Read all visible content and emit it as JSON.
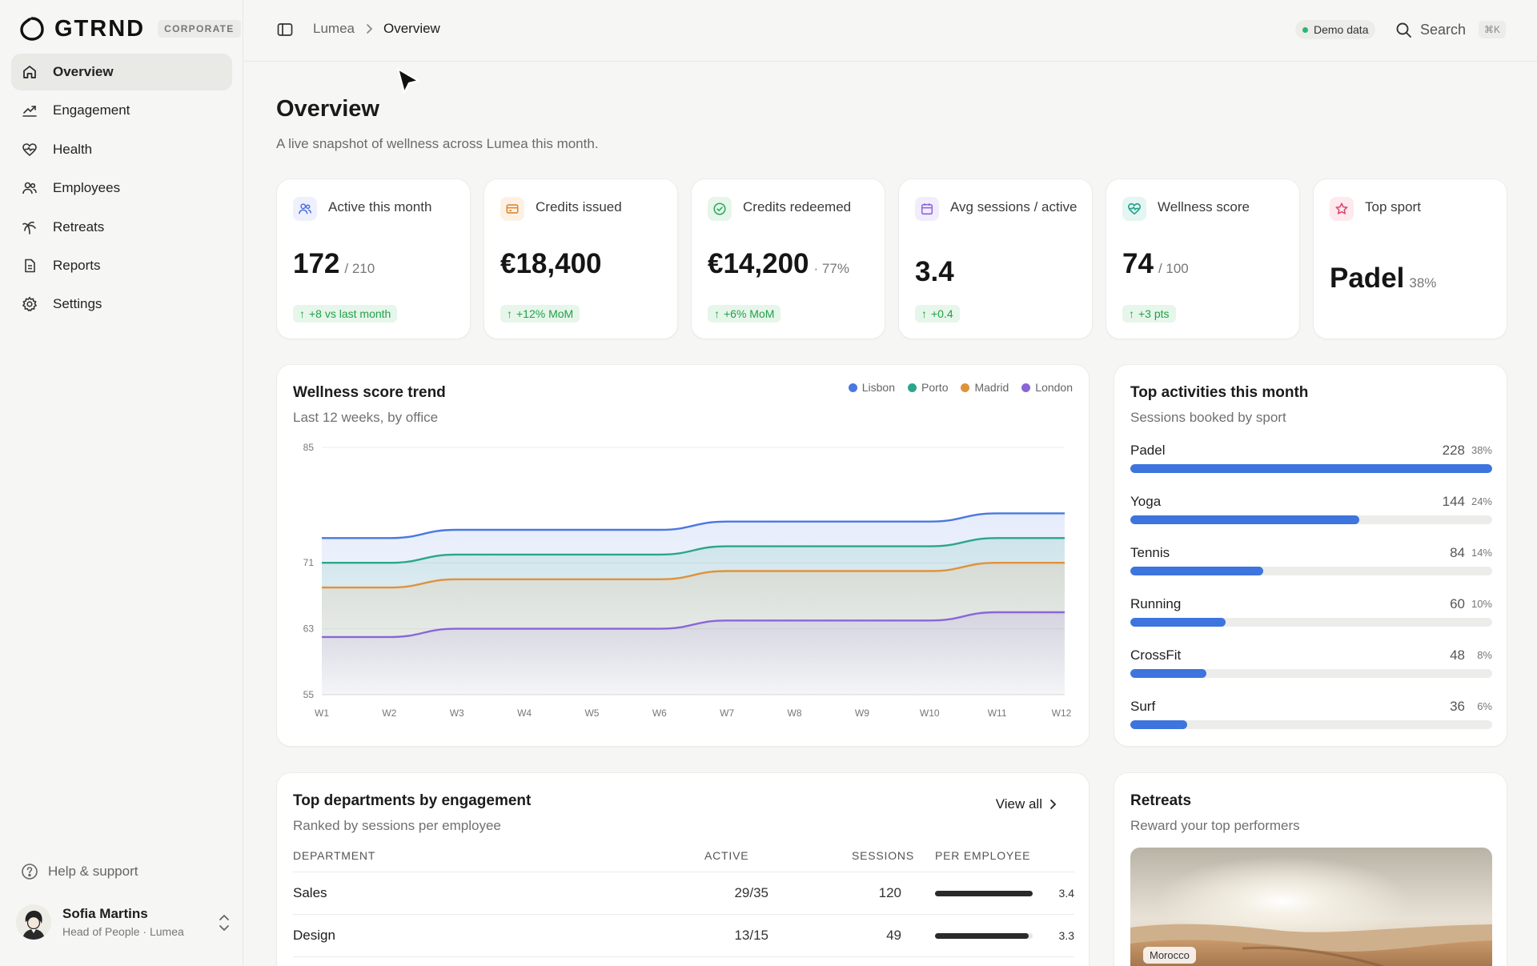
{
  "brand": {
    "name": "GTRND",
    "badge": "CORPORATE"
  },
  "nav": [
    {
      "label": "Overview",
      "icon": "home-icon"
    },
    {
      "label": "Engagement",
      "icon": "trend-chart-icon"
    },
    {
      "label": "Health",
      "icon": "heart-pulse-icon"
    },
    {
      "label": "Employees",
      "icon": "users-icon"
    },
    {
      "label": "Retreats",
      "icon": "palm-tree-icon"
    },
    {
      "label": "Reports",
      "icon": "document-icon"
    },
    {
      "label": "Settings",
      "icon": "gear-icon"
    }
  ],
  "help": {
    "label": "Help & support"
  },
  "user": {
    "name": "Sofia Martins",
    "role": "Head of People · Lumea"
  },
  "topbar": {
    "breadcrumb_root": "Lumea",
    "breadcrumb_current": "Overview",
    "demo_label": "Demo data",
    "search_label": "Search",
    "search_shortcut": "⌘K"
  },
  "page": {
    "title": "Overview",
    "subtitle": "A live snapshot of wellness across Lumea this month."
  },
  "kpis": [
    {
      "label": "Active this month",
      "value": "172",
      "suffix": "/ 210",
      "delta": "+8 vs last month",
      "icon": "users-icon",
      "color": "#4f6fe0"
    },
    {
      "label": "Credits issued",
      "value": "€18,400",
      "suffix": "",
      "delta": "+12% MoM",
      "icon": "card-icon",
      "color": "#e0862a"
    },
    {
      "label": "Credits redeemed",
      "value": "€14,200",
      "suffix": "· 77%",
      "delta": "+6% MoM",
      "icon": "check-circle-icon",
      "color": "#27a65a"
    },
    {
      "label": "Avg sessions / active",
      "value": "3.4",
      "suffix": "",
      "delta": "+0.4",
      "icon": "calendar-icon",
      "color": "#8c63e0"
    },
    {
      "label": "Wellness score",
      "value": "74",
      "suffix": "/ 100",
      "delta": "+3 pts",
      "icon": "heart-pulse-icon",
      "color": "#1e9e8c"
    },
    {
      "label": "Top sport",
      "value": "Padel",
      "suffix": "38%",
      "delta": "",
      "icon": "star-icon",
      "color": "#e0456e"
    }
  ],
  "trend": {
    "title": "Wellness score trend",
    "subtitle": "Last 12 weeks, by office"
  },
  "chart_data": {
    "type": "area",
    "x": [
      "W1",
      "W2",
      "W3",
      "W4",
      "W5",
      "W6",
      "W7",
      "W8",
      "W9",
      "W10",
      "W11",
      "W12"
    ],
    "yticks": [
      85,
      71,
      63,
      55
    ],
    "ylim": [
      55,
      85
    ],
    "series": [
      {
        "name": "Lisbon",
        "color": "#4a78e0",
        "values": [
          74,
          74,
          75,
          75,
          75,
          75,
          76,
          76,
          76,
          76,
          77,
          77
        ]
      },
      {
        "name": "Porto",
        "color": "#2ba68a",
        "values": [
          71,
          71,
          72,
          72,
          72,
          72,
          73,
          73,
          73,
          73,
          74,
          74
        ]
      },
      {
        "name": "Madrid",
        "color": "#e0923a",
        "values": [
          68,
          68,
          69,
          69,
          69,
          69,
          70,
          70,
          70,
          70,
          71,
          71
        ]
      },
      {
        "name": "London",
        "color": "#8a66d8",
        "values": [
          62,
          62,
          63,
          63,
          63,
          63,
          64,
          64,
          64,
          64,
          65,
          65
        ]
      }
    ],
    "grid": true,
    "legend": "top-right"
  },
  "activities": {
    "title": "Top activities this month",
    "subtitle": "Sessions booked by sport",
    "items": [
      {
        "name": "Padel",
        "count": "228",
        "pct": "38%",
        "share": 1.0
      },
      {
        "name": "Yoga",
        "count": "144",
        "pct": "24%",
        "share": 0.632
      },
      {
        "name": "Tennis",
        "count": "84",
        "pct": "14%",
        "share": 0.368
      },
      {
        "name": "Running",
        "count": "60",
        "pct": "10%",
        "share": 0.263
      },
      {
        "name": "CrossFit",
        "count": "48",
        "pct": "8%",
        "share": 0.211
      },
      {
        "name": "Surf",
        "count": "36",
        "pct": "6%",
        "share": 0.158
      }
    ]
  },
  "departments": {
    "title": "Top departments by engagement",
    "subtitle": "Ranked by sessions per employee",
    "view_all": "View all",
    "columns": [
      "DEPARTMENT",
      "ACTIVE",
      "SESSIONS",
      "PER EMPLOYEE"
    ],
    "rows": [
      {
        "name": "Sales",
        "active": "29/35",
        "sessions": "120",
        "per_employee": "3.4",
        "share": 1.0
      },
      {
        "name": "Design",
        "active": "13/15",
        "sessions": "49",
        "per_employee": "3.3",
        "share": 0.96
      }
    ]
  },
  "retreats": {
    "title": "Retreats",
    "subtitle": "Reward your top performers",
    "tag": "Morocco"
  }
}
